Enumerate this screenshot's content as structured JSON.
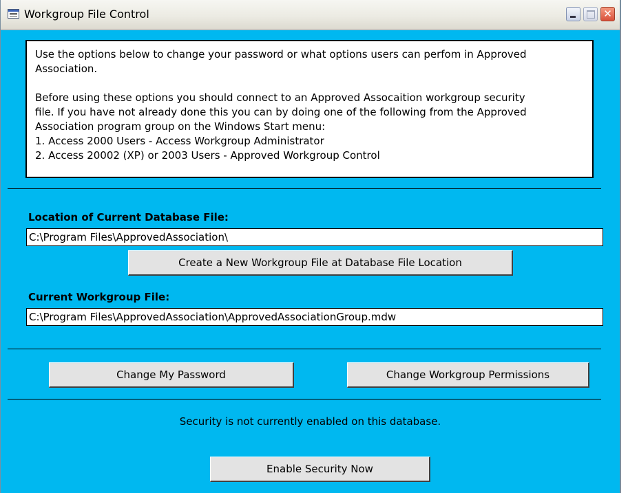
{
  "window": {
    "title": "Workgroup File Control"
  },
  "info": {
    "paragraph1": "Use the options below to change your password or what options users can perfom in Approved Association.",
    "paragraph2_lines": [
      "Before using these options you should connect to an Approved Assocaition workgroup security",
      "file.  If you have not already done this you can by doing one of the following from the Approved",
      "Association program group on the Windows Start menu:",
      "1. Access 2000 Users - Access Workgroup Administrator",
      "2. Access 20002 (XP) or 2003 Users - Approved Workgroup Control"
    ]
  },
  "database_location": {
    "label": "Location of Current Database File:",
    "value": "C:\\Program Files\\ApprovedAssociation\\"
  },
  "create_workgroup_button": "Create a New Workgroup File at Database File Location",
  "workgroup_file": {
    "label": "Current Workgroup File:",
    "value": "C:\\Program Files\\ApprovedAssociation\\ApprovedAssociationGroup.mdw"
  },
  "change_password_button": "Change My Password",
  "change_permissions_button": "Change Workgroup Permissions",
  "status_text": "Security is not currently enabled on this database.",
  "enable_security_button": "Enable Security Now",
  "colors": {
    "background": "#00b8f0",
    "button": "#e3e3e3"
  }
}
